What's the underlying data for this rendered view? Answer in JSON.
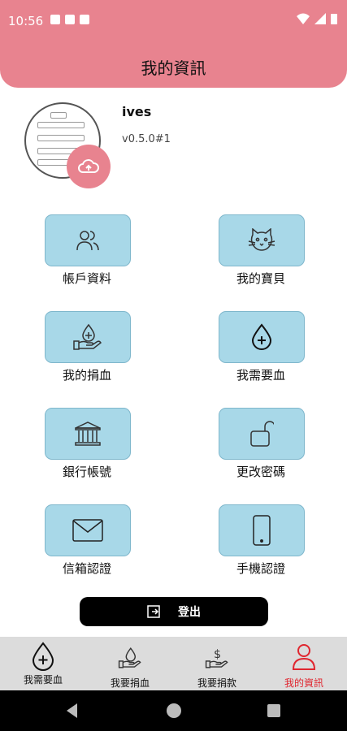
{
  "status_bar": {
    "time": "10:56"
  },
  "header": {
    "title": "我的資訊"
  },
  "profile": {
    "username": "ives",
    "version": "v0.5.0#1"
  },
  "menu": {
    "account_profile": "帳戶資料",
    "my_pets": "我的寶貝",
    "my_donations": "我的捐血",
    "need_blood": "我需要血",
    "bank_account": "銀行帳號",
    "change_password": "更改密碼",
    "email_verify": "信箱認證",
    "phone_verify": "手機認證"
  },
  "logout": {
    "label": "登出"
  },
  "bottom_nav": {
    "items": [
      {
        "label": "我需要血",
        "icon": "blood-drop-plus-icon"
      },
      {
        "label": "我要捐血",
        "icon": "hand-blood-drop-icon"
      },
      {
        "label": "我要捐款",
        "icon": "hand-dollar-icon"
      },
      {
        "label": "我的資訊",
        "icon": "person-icon",
        "active": true
      }
    ]
  },
  "colors": {
    "primary": "#e8838f",
    "tile": "#a8d8e8",
    "active_nav": "#e0262f"
  }
}
